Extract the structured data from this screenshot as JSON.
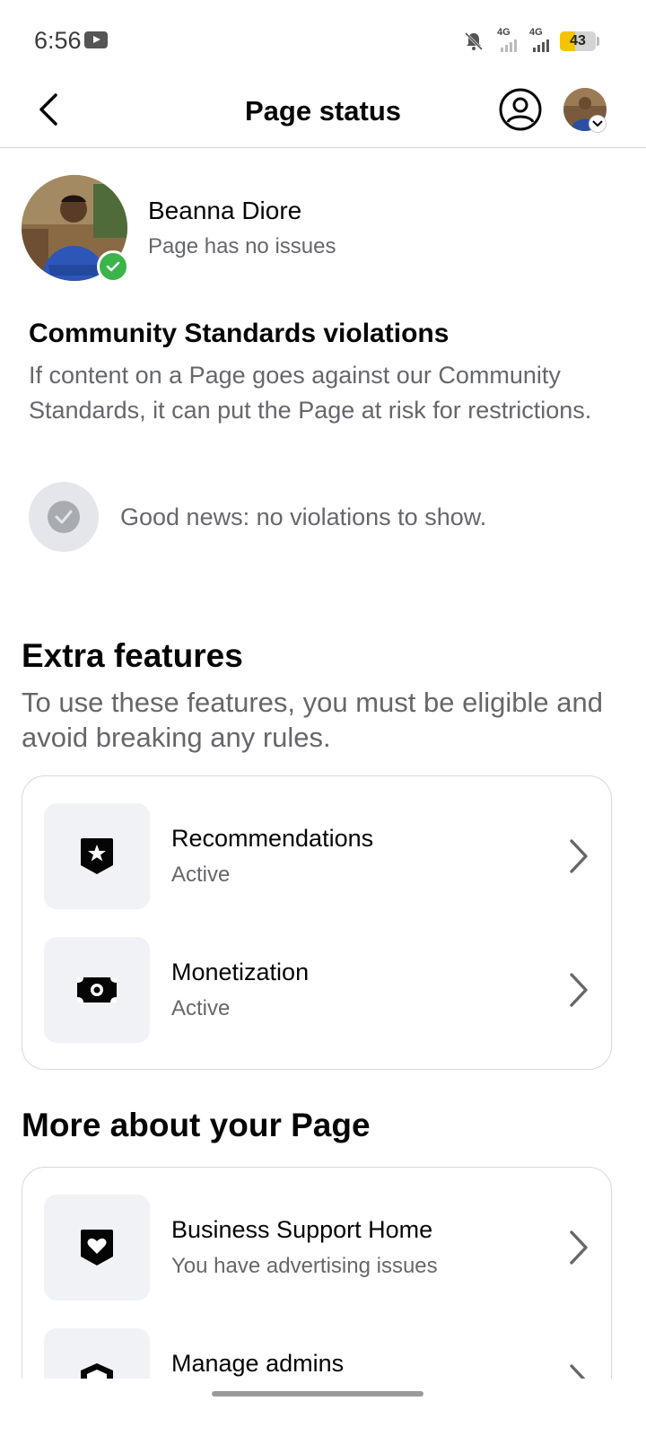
{
  "status_bar": {
    "time": "6:56",
    "network_1": "4G",
    "network_2": "4G",
    "battery_level": "43",
    "battery_fraction": 0.43
  },
  "header": {
    "title": "Page status",
    "back_icon": "back-arrow-icon",
    "profile_icon": "profile-circle-icon"
  },
  "page": {
    "name": "Beanna Diore",
    "health": "Page has no issues",
    "badge_color": "#3bb44a"
  },
  "community_standards": {
    "title": "Community Standards violations",
    "description": "If content on a Page goes against our Community Standards, it can put the Page at risk for restrictions.",
    "status": "Good news: no violations to show."
  },
  "extra_features": {
    "title": "Extra features",
    "description": "To use these features, you must be eligible and avoid breaking any rules.",
    "items": [
      {
        "title": "Recommendations",
        "status": "Active",
        "icon": "star-badge-icon"
      },
      {
        "title": "Monetization",
        "status": "Active",
        "icon": "money-icon"
      }
    ]
  },
  "more_about": {
    "title": "More about your Page",
    "items": [
      {
        "title": "Business Support Home",
        "status": "You have advertising issues",
        "icon": "heart-badge-icon"
      },
      {
        "title": "Manage admins",
        "status": "",
        "icon": "shield-icon"
      }
    ]
  }
}
